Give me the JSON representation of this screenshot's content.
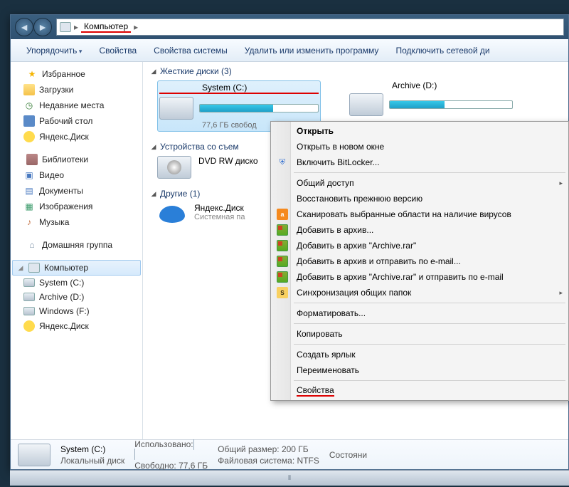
{
  "nav": {
    "location": "Компьютер"
  },
  "toolbar": {
    "organize": "Упорядочить",
    "properties": "Свойства",
    "system_properties": "Свойства системы",
    "uninstall": "Удалить или изменить программу",
    "map_drive": "Подключить сетевой ди"
  },
  "sidebar": {
    "favorites": "Избранное",
    "downloads": "Загрузки",
    "recent": "Недавние места",
    "desktop": "Рабочий стол",
    "yandex_disk": "Яндекс.Диск",
    "libraries": "Библиотеки",
    "videos": "Видео",
    "documents": "Документы",
    "pictures": "Изображения",
    "music": "Музыка",
    "homegroup": "Домашняя группа",
    "computer": "Компьютер",
    "drive_c": "System (C:)",
    "drive_d": "Archive (D:)",
    "drive_f": "Windows (F:)",
    "drive_y": "Яндекс.Диск"
  },
  "sections": {
    "hard_drives": "Жесткие диски (3)",
    "removable": "Устройства со съем",
    "other": "Другие (1)"
  },
  "drives": {
    "c": {
      "name": "System (C:)",
      "free": "77,6 ГБ свобод",
      "fill_pct": 62
    },
    "d": {
      "name": "Archive (D:)",
      "fill_pct": 45
    },
    "dvd": {
      "name": "DVD RW диско"
    },
    "yd": {
      "name": "Яндекс.Диск",
      "sub": "Системная па"
    }
  },
  "ctx": {
    "open": "Открыть",
    "open_new": "Открыть в новом окне",
    "bitlocker": "Включить BitLocker...",
    "share": "Общий доступ",
    "restore": "Восстановить прежнюю версию",
    "scan": "Сканировать выбранные области на наличие вирусов",
    "add_archive": "Добавить в архив...",
    "add_archive_rar": "Добавить в архив \"Archive.rar\"",
    "add_email": "Добавить в архив и отправить по e-mail...",
    "add_rar_email": "Добавить в архив \"Archive.rar\" и отправить по e-mail",
    "sync": "Синхронизация общих папок",
    "format": "Форматировать...",
    "copy": "Копировать",
    "shortcut": "Создать ярлык",
    "rename": "Переименовать",
    "properties": "Свойства"
  },
  "status": {
    "name": "System (C:)",
    "type": "Локальный диск",
    "used_label": "Использовано:",
    "free_label": "Свободно:",
    "free_value": "77,6 ГБ",
    "total_label": "Общий размер:",
    "total_value": "200 ГБ",
    "fs_label": "Файловая система:",
    "fs_value": "NTFS",
    "state": "Состояни"
  }
}
